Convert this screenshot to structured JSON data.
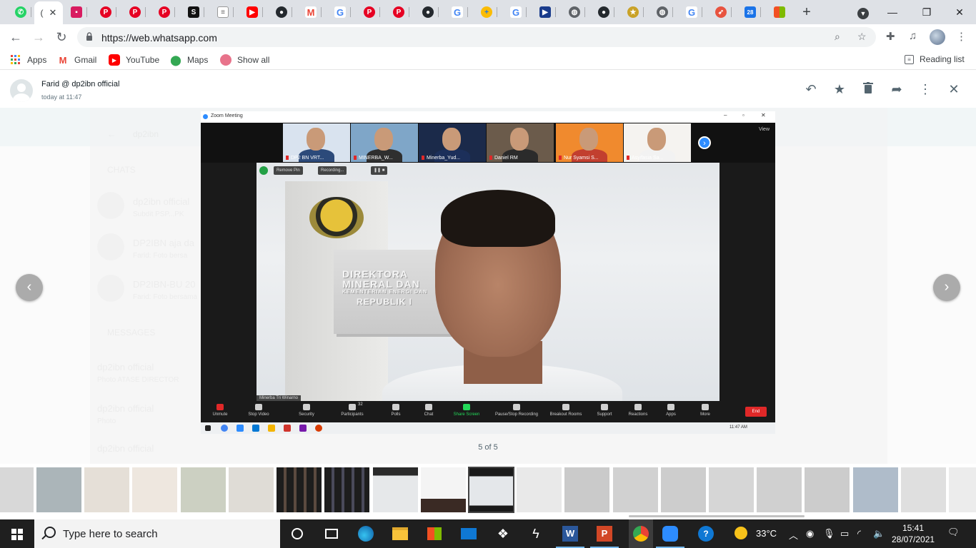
{
  "browser": {
    "active_tab_label": "(",
    "url": "https://web.whatsapp.com",
    "bookmarks": [
      {
        "label": "Apps"
      },
      {
        "label": "Gmail"
      },
      {
        "label": "YouTube"
      },
      {
        "label": "Maps"
      },
      {
        "label": "Show all"
      }
    ],
    "reading_list": "Reading list",
    "tab_icons": [
      "whatsapp-icon",
      "whatsapp-icon",
      "contact-icon",
      "pinterest-icon",
      "pinterest-icon",
      "pinterest-icon",
      "s-icon",
      "note-icon",
      "youtube-icon",
      "github-icon",
      "gmail-icon",
      "google-icon",
      "pinterest-icon",
      "pinterest-icon",
      "github-icon",
      "google-icon",
      "lens-icon",
      "google-icon",
      "flag-icon",
      "globe-icon",
      "github-icon",
      "emblem-icon",
      "globe-icon",
      "google-icon",
      "rocket-icon",
      "calendar-icon",
      "ms-icon"
    ],
    "calendar_day": "28"
  },
  "viewer": {
    "sender": "Farid @ dp2ibn official",
    "timestamp": "today at 11:47",
    "counter": "5 of 5",
    "ghost": {
      "chats_label": "CHATS",
      "search_text": "dp2ibn",
      "items": [
        {
          "title": "dp2ibn official",
          "sub": "Subdit PSP...PK"
        },
        {
          "title": "DP2IBN aja da",
          "sub": "Farid: Foto bersa"
        },
        {
          "title": "DP2IBN-BU 20",
          "sub": "Farid: Foto bersama"
        }
      ],
      "messages_label": "MESSAGES",
      "msgs": [
        {
          "title": "dp2ibn official",
          "sub": "Photo ATASE DIRECTOR"
        },
        {
          "title": "dp2ibn official",
          "sub": "Photo"
        },
        {
          "title": "dp2ibn official",
          "sub": ""
        }
      ]
    }
  },
  "zoom": {
    "window_title": "Zoom Meeting",
    "view_label": "View",
    "participants": [
      {
        "name": "DP2 BN VRT...",
        "body": "#2c4a7a",
        "bg": "#d9e3ef"
      },
      {
        "name": "MINERBA_W...",
        "body": "#2f2f2f",
        "bg": "#7fa6c8"
      },
      {
        "name": "Minerba_Yud...",
        "body": "#1c2f5a",
        "bg": "#1b2a4a"
      },
      {
        "name": "Daniel RM",
        "body": "#2b2b2b",
        "bg": "#6b5b4b"
      },
      {
        "name": "Nur Syamsi S...",
        "body": "#c23f2f",
        "bg": "#f08a2e"
      },
      {
        "name": "Asyifasia Sa...",
        "body": "#f2f2f2",
        "bg": "#f5f3f0"
      }
    ],
    "sign_lines": [
      "DIREKTORA",
      "MINERAL DAN",
      "KEMENTERIAN ENERGI DAN",
      "REPUBLIK I"
    ],
    "pin_label": "Remove Pin",
    "recording_label": "Recording...",
    "speaker_name": "Minerba Tri Winarno",
    "participant_count": "32",
    "controls": [
      {
        "label": "Unmute"
      },
      {
        "label": "Stop Video"
      },
      {
        "label": "Security"
      },
      {
        "label": "Participants"
      },
      {
        "label": "Polls"
      },
      {
        "label": "Chat"
      },
      {
        "label": "Share Screen"
      },
      {
        "label": "Pause/Stop Recording"
      },
      {
        "label": "Breakout Rooms"
      },
      {
        "label": "Support"
      },
      {
        "label": "Reactions"
      },
      {
        "label": "Apps"
      },
      {
        "label": "More"
      }
    ],
    "end_label": "End",
    "inner_clock": "11:47 AM"
  },
  "taskbar": {
    "search_placeholder": "Type here to search",
    "weather": "33°C",
    "time": "15:41",
    "date": "28/07/2021"
  },
  "colors": {
    "chrome_tabstrip": "#dee1e6",
    "zoom_blue": "#2d8cff",
    "zoom_green": "#23d959",
    "zoom_end": "#e02828",
    "taskbar": "#1f1f1f"
  }
}
